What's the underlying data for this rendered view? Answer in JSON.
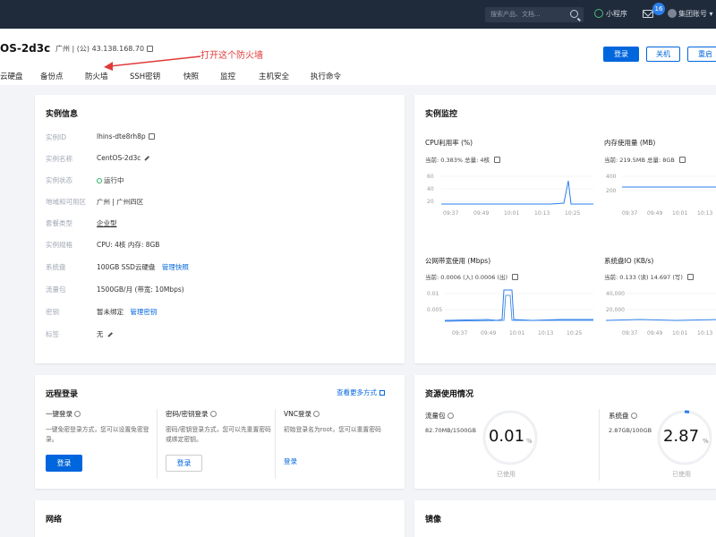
{
  "topbar": {
    "search_placeholder": "搜索产品、文档...",
    "mini_program": "小程序",
    "message_count": "16",
    "account": "集团账号 ▾"
  },
  "header": {
    "instance_title": "OS-2d3c",
    "instance_ip": "广州 | (公) 43.138.168.70",
    "annotation": "打开这个防火墙",
    "buttons": {
      "login": "登录",
      "shutdown": "关机",
      "restart": "重启"
    }
  },
  "tabs": [
    "云硬盘",
    "备份点",
    "防火墙",
    "SSH密钥",
    "快照",
    "监控",
    "主机安全",
    "执行命令"
  ],
  "instance_info": {
    "title": "实例信息",
    "rows": [
      {
        "label": "实例ID",
        "value": "lhins-dte8rh8p"
      },
      {
        "label": "实例名称",
        "value": "CentOS-2d3c"
      },
      {
        "label": "实例状态",
        "value": "运行中"
      },
      {
        "label": "地域和可用区",
        "value": "广州 | 广州四区"
      },
      {
        "label": "套餐类型",
        "value": "企业型"
      },
      {
        "label": "实例规格",
        "value": "CPU: 4核 内存: 8GB"
      },
      {
        "label": "系统盘",
        "value": "100GB SSD云硬盘",
        "link": "管理快照"
      },
      {
        "label": "流量包",
        "value": "1500GB/月 (带宽: 10Mbps)"
      },
      {
        "label": "密钥",
        "value": "暂未绑定",
        "link": "管理密钥"
      },
      {
        "label": "标签",
        "value": "无"
      }
    ]
  },
  "monitoring": {
    "title": "实例监控",
    "charts": [
      {
        "title": "CPU利用率 (%)",
        "current": "当前: 0.383% 总量: 4核",
        "yticks": [
          "60",
          "40",
          "20"
        ],
        "xticks": [
          "09:37",
          "09:49",
          "10:01",
          "10:13",
          "10:25"
        ]
      },
      {
        "title": "内存使用量 (MB)",
        "current": "当前: 219.5MB 总量: 8GB",
        "yticks": [
          "400",
          "200"
        ],
        "xticks": [
          "09:37",
          "09:49",
          "10:01",
          "10:13",
          "10:25"
        ]
      },
      {
        "title": "公网带宽使用 (Mbps)",
        "current": "当前: 0.0006 (入) 0.0006 (出)",
        "yticks": [
          "0.01",
          "0.005"
        ],
        "xticks": [
          "09:37",
          "09:49",
          "10:01",
          "10:13",
          "10:25"
        ]
      },
      {
        "title": "系统盘IO (KB/s)",
        "current": "当前: 0.133 (读) 14.697 (写)",
        "yticks": [
          "40,000",
          "20,000"
        ],
        "xticks": [
          "09:37",
          "09:49",
          "10:01",
          "10:13",
          "10:25"
        ]
      }
    ]
  },
  "remote_login": {
    "title": "远程登录",
    "more_link": "查看更多方式",
    "col1": {
      "title": "一键登录",
      "desc": "一键免密登录方式，您可以设置免密登录。",
      "button": "登录"
    },
    "col2": {
      "title": "密码/密钥登录",
      "desc": "密码/密钥登录方式，您可以先重置密码或绑定密钥。",
      "button": "登录"
    },
    "col3": {
      "title": "VNC登录",
      "desc": "初始登录名为root，您可以重置密码",
      "button": "登录"
    }
  },
  "resources": {
    "title": "资源使用情况",
    "traffic": {
      "title": "流量包",
      "usage": "82.70MB/1500GB",
      "percent": "0.01",
      "unit": "%",
      "label": "已使用"
    },
    "disk": {
      "title": "系统盘",
      "usage": "2.87GB/100GB",
      "percent": "2.87",
      "unit": "%",
      "label": "已使用"
    }
  },
  "bottom": {
    "network": "网络",
    "image": "镜像"
  }
}
